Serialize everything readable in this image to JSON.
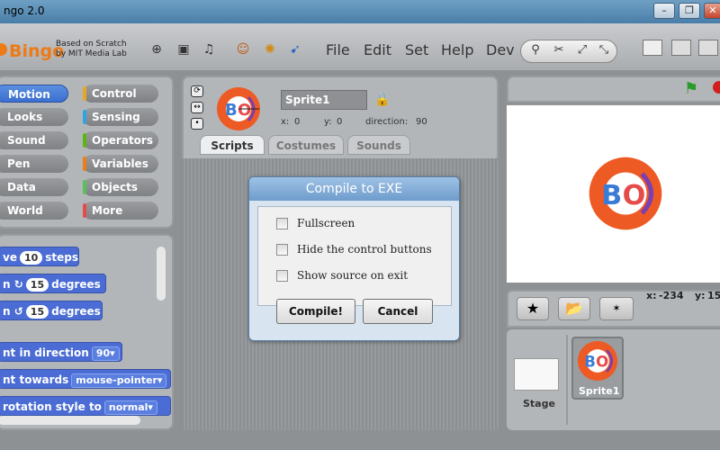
{
  "window": {
    "title": "ngo 2.0",
    "minimize": "–",
    "maximize": "❐",
    "close": "✕"
  },
  "header": {
    "logo": "Bingo",
    "based_line1": "Based on Scratch",
    "based_line2": "by MIT Media Lab",
    "menus": [
      "File",
      "Edit",
      "Set",
      "Help",
      "Dev"
    ],
    "toolbar_icons": [
      "globe-icon",
      "save-icon",
      "share-icon",
      "character-icon",
      "compass-icon",
      "cursor-icon"
    ]
  },
  "categories": [
    {
      "label": "Motion",
      "color": "#4a6cd4"
    },
    {
      "label": "Control",
      "color": "#e6a822"
    },
    {
      "label": "Looks",
      "color": "#8a55d7"
    },
    {
      "label": "Sensing",
      "color": "#2ca5e2"
    },
    {
      "label": "Sound",
      "color": "#bb42c3"
    },
    {
      "label": "Operators",
      "color": "#5cb712"
    },
    {
      "label": "Pen",
      "color": "#0e9a6c"
    },
    {
      "label": "Variables",
      "color": "#ee7d16"
    },
    {
      "label": "Data",
      "color": "#cc5b22"
    },
    {
      "label": "Objects",
      "color": "#59c059"
    },
    {
      "label": "World",
      "color": "#5cb712"
    },
    {
      "label": "More",
      "color": "#e64b4b"
    }
  ],
  "blocks": {
    "move": {
      "pre": "ve",
      "val": "10",
      "post": "steps"
    },
    "turn_right": {
      "pre": "n",
      "icon": "↻",
      "val": "15",
      "post": "degrees"
    },
    "turn_left": {
      "pre": "n",
      "icon": "↺",
      "val": "15",
      "post": "degrees"
    },
    "point_direction": {
      "pre": "nt in direction",
      "val": "90▾"
    },
    "point_towards": {
      "pre": "nt towards",
      "val": "mouse-pointer▾"
    },
    "rotation_style": {
      "pre": "rotation style to",
      "val": "normal▾"
    }
  },
  "sprite": {
    "name": "Sprite1",
    "x_label": "x:",
    "x": "0",
    "y_label": "y:",
    "y": "0",
    "direction_label": "direction:",
    "direction": "90"
  },
  "tabs": [
    "Scripts",
    "Costumes",
    "Sounds"
  ],
  "dialog": {
    "title": "Compile to EXE",
    "options": [
      "Fullscreen",
      "Hide the control buttons",
      "Show source on exit"
    ],
    "compile_label": "Compile!",
    "cancel_label": "Cancel"
  },
  "stage": {
    "mouse_x_label": "x:",
    "mouse_x": "-234",
    "mouse_y_label": "y:",
    "mouse_y": "15"
  },
  "sprite_panel": {
    "stage_label": "Stage",
    "sprite_label": "Sprite1"
  },
  "colors": {
    "logo_orange": "#ee7a16",
    "motion_blue": "#4a6cd4",
    "dialog_title": "#6e9ccc"
  }
}
